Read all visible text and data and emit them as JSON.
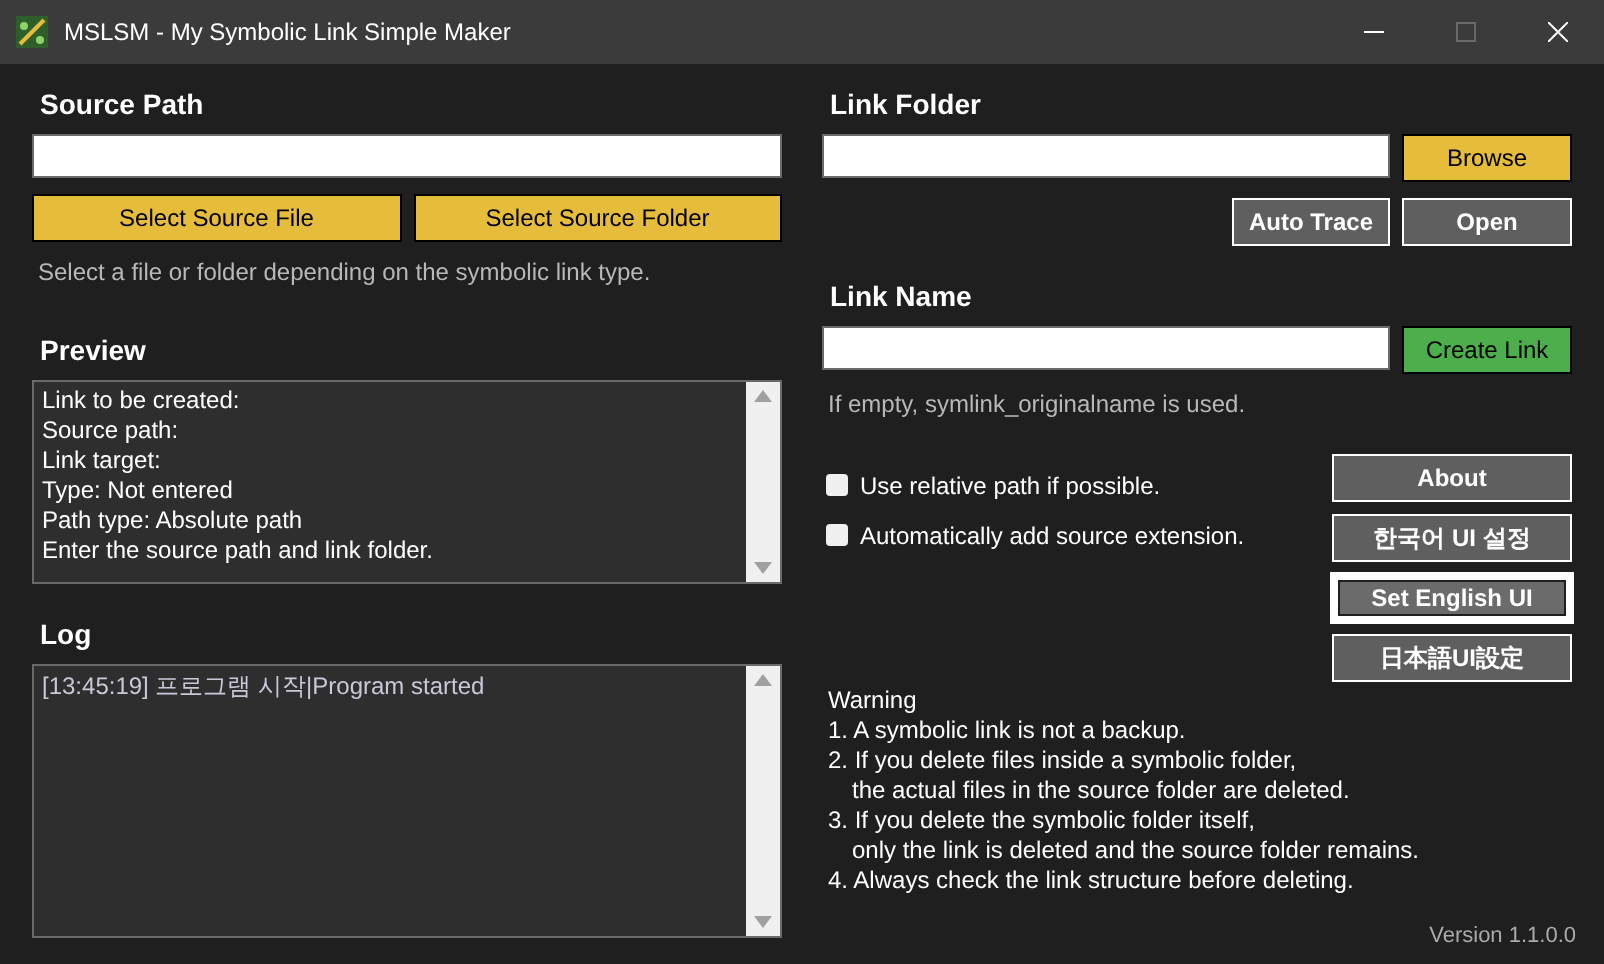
{
  "window": {
    "title": "MSLSM - My Symbolic Link Simple Maker",
    "maximize_disabled": true
  },
  "source": {
    "heading": "Source Path",
    "buttons": [
      "Select Source File",
      "Select Source Folder"
    ],
    "hint": "Select a file or folder depending on the symbolic link type."
  },
  "preview": {
    "heading": "Preview",
    "lines": [
      "Link to be created:",
      "Source path:",
      "Link target:",
      "Type: Not entered",
      "Path type: Absolute path",
      "Enter the source path and link folder."
    ]
  },
  "log": {
    "heading": "Log",
    "entries": [
      "[13:45:19] 프로그램 시작|Program started"
    ]
  },
  "link_folder": {
    "heading": "Link Folder",
    "browse": "Browse",
    "auto_trace": "Auto Trace",
    "open": "Open"
  },
  "link_name": {
    "heading": "Link Name",
    "create": "Create Link",
    "hint": "If empty, symlink_originalname is used."
  },
  "options": [
    {
      "label": "Use relative path if possible.",
      "checked": false
    },
    {
      "label": "Automatically add source extension.",
      "checked": false
    }
  ],
  "about": "About",
  "languages": [
    {
      "label": "한국어 UI 설정",
      "selected": false
    },
    {
      "label": "Set English UI",
      "selected": true
    },
    {
      "label": "日本語UI設定",
      "selected": false
    }
  ],
  "warning": {
    "title": "Warning",
    "items": [
      [
        "1. A symbolic link is not a backup."
      ],
      [
        "2. If you delete files inside a symbolic folder,",
        "the actual files in the source folder are deleted."
      ],
      [
        "3. If you delete the symbolic folder itself,",
        "only the link is deleted and the source folder remains."
      ],
      [
        "4. Always check the link structure before deleting."
      ]
    ]
  },
  "version": "Version 1.1.0.0"
}
